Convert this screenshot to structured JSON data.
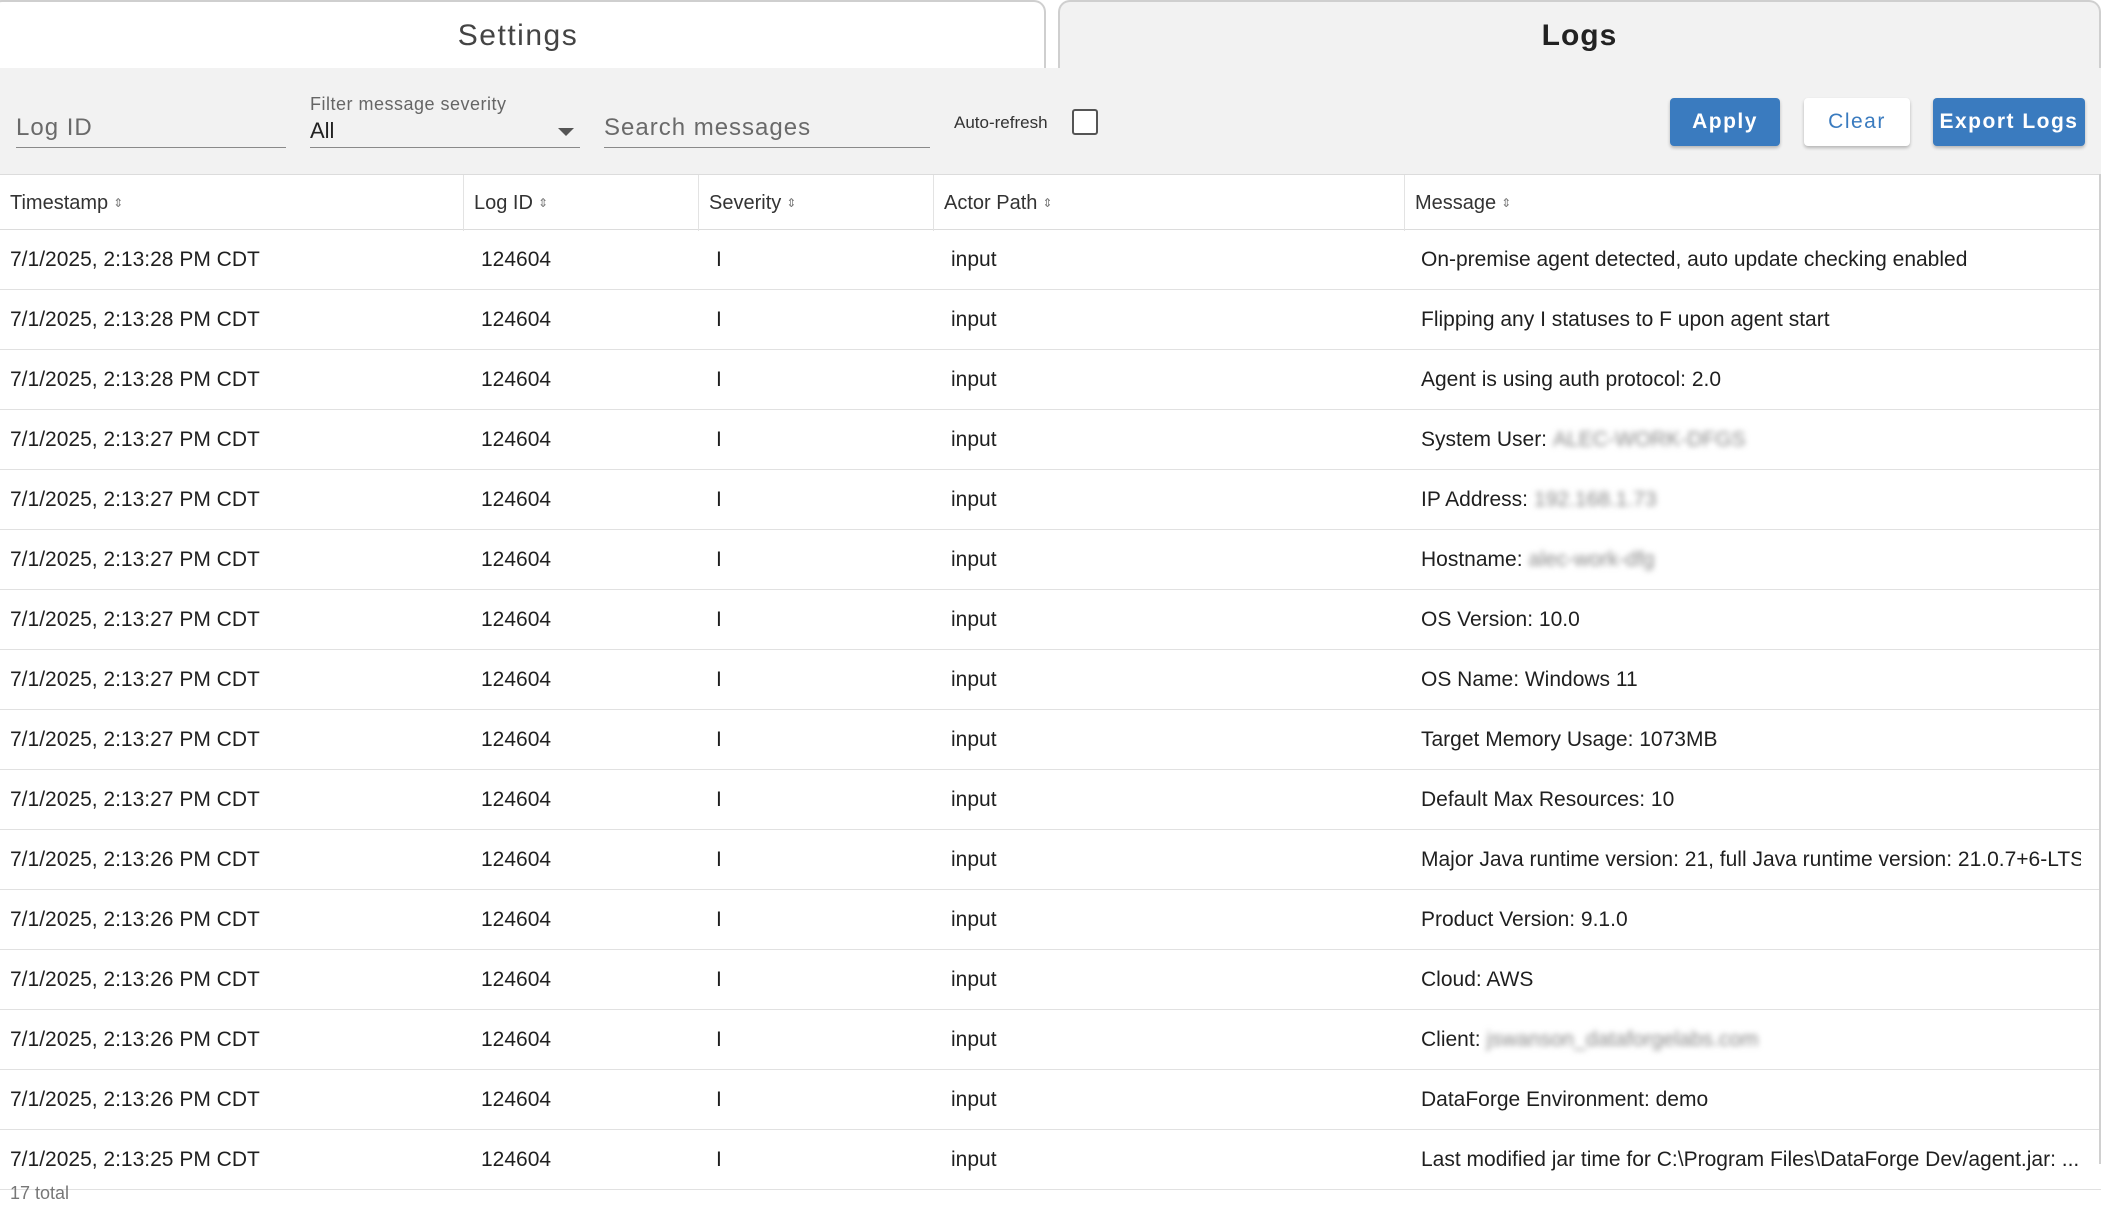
{
  "tabs": {
    "settings": "Settings",
    "logs": "Logs"
  },
  "toolbar": {
    "log_id_placeholder": "Log ID",
    "severity_label": "Filter message severity",
    "severity_value": "All",
    "search_placeholder": "Search messages",
    "autorefresh_label": "Auto-refresh",
    "autorefresh_checked": false,
    "apply_label": "Apply",
    "clear_label": "Clear",
    "export_label": "Export Logs"
  },
  "table": {
    "columns": [
      "Timestamp",
      "Log ID",
      "Severity",
      "Actor Path",
      "Message"
    ],
    "rows": [
      {
        "timestamp": "7/1/2025, 2:13:28 PM CDT",
        "log_id": "124604",
        "severity": "I",
        "actor_path": "input",
        "message": "On-premise agent detected, auto update checking enabled",
        "redacted": ""
      },
      {
        "timestamp": "7/1/2025, 2:13:28 PM CDT",
        "log_id": "124604",
        "severity": "I",
        "actor_path": "input",
        "message": "Flipping any I statuses to F upon agent start",
        "redacted": ""
      },
      {
        "timestamp": "7/1/2025, 2:13:28 PM CDT",
        "log_id": "124604",
        "severity": "I",
        "actor_path": "input",
        "message": "Agent is using auth protocol: 2.0",
        "redacted": ""
      },
      {
        "timestamp": "7/1/2025, 2:13:27 PM CDT",
        "log_id": "124604",
        "severity": "I",
        "actor_path": "input",
        "message": "System User:",
        "redacted": "ALEC-WORK-DFGS"
      },
      {
        "timestamp": "7/1/2025, 2:13:27 PM CDT",
        "log_id": "124604",
        "severity": "I",
        "actor_path": "input",
        "message": "IP Address:",
        "redacted": "192.168.1.73"
      },
      {
        "timestamp": "7/1/2025, 2:13:27 PM CDT",
        "log_id": "124604",
        "severity": "I",
        "actor_path": "input",
        "message": "Hostname:",
        "redacted": "alec-work-dfg"
      },
      {
        "timestamp": "7/1/2025, 2:13:27 PM CDT",
        "log_id": "124604",
        "severity": "I",
        "actor_path": "input",
        "message": "OS Version: 10.0",
        "redacted": ""
      },
      {
        "timestamp": "7/1/2025, 2:13:27 PM CDT",
        "log_id": "124604",
        "severity": "I",
        "actor_path": "input",
        "message": "OS Name: Windows 11",
        "redacted": ""
      },
      {
        "timestamp": "7/1/2025, 2:13:27 PM CDT",
        "log_id": "124604",
        "severity": "I",
        "actor_path": "input",
        "message": "Target Memory Usage: 1073MB",
        "redacted": ""
      },
      {
        "timestamp": "7/1/2025, 2:13:27 PM CDT",
        "log_id": "124604",
        "severity": "I",
        "actor_path": "input",
        "message": "Default Max Resources: 10",
        "redacted": ""
      },
      {
        "timestamp": "7/1/2025, 2:13:26 PM CDT",
        "log_id": "124604",
        "severity": "I",
        "actor_path": "input",
        "message": "Major Java runtime version: 21, full Java runtime version: 21.0.7+6-LTS",
        "redacted": ""
      },
      {
        "timestamp": "7/1/2025, 2:13:26 PM CDT",
        "log_id": "124604",
        "severity": "I",
        "actor_path": "input",
        "message": "Product Version: 9.1.0",
        "redacted": ""
      },
      {
        "timestamp": "7/1/2025, 2:13:26 PM CDT",
        "log_id": "124604",
        "severity": "I",
        "actor_path": "input",
        "message": "Cloud: AWS",
        "redacted": ""
      },
      {
        "timestamp": "7/1/2025, 2:13:26 PM CDT",
        "log_id": "124604",
        "severity": "I",
        "actor_path": "input",
        "message": "Client:",
        "redacted": "jswanson_dataforgelabs.com"
      },
      {
        "timestamp": "7/1/2025, 2:13:26 PM CDT",
        "log_id": "124604",
        "severity": "I",
        "actor_path": "input",
        "message": "DataForge Environment: demo",
        "redacted": ""
      },
      {
        "timestamp": "7/1/2025, 2:13:25 PM CDT",
        "log_id": "124604",
        "severity": "I",
        "actor_path": "input",
        "message": "Last modified jar time for C:\\Program Files\\DataForge Dev/agent.jar: ...",
        "redacted": ""
      }
    ]
  },
  "footer": {
    "total": "17 total"
  }
}
